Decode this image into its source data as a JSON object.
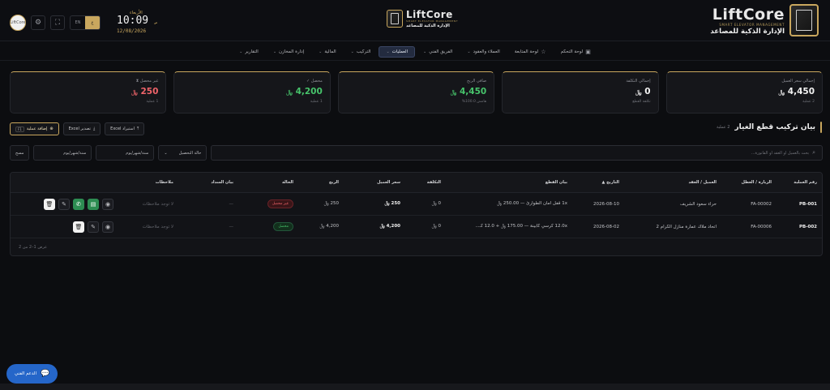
{
  "header": {
    "brand": {
      "name": "LiftCore",
      "tagline": "SMART ELEVATOR MANAGEMENT",
      "subtitle": "الإدارة الذكية للمصاعد"
    },
    "center_brand": {
      "name": "LiftCore",
      "tagline": "SMART ELEVATOR MANAGEMENT",
      "subtitle": "الإدارة الذكية للمصاعد"
    },
    "clock": {
      "day": "الأربعاء",
      "time": "10:09",
      "ampm": "ص",
      "date": "12/08/2026"
    },
    "lang": {
      "en": "EN",
      "ar": "ع"
    },
    "avatar_text": "LiftCore",
    "icons": {
      "settings": "gear-icon",
      "fullscreen": "fullscreen-icon"
    }
  },
  "nav": [
    {
      "label": "لوحة التحكم",
      "icon": "▣",
      "chev": ""
    },
    {
      "label": "لوحة المتابعة",
      "icon": "☆",
      "chev": ""
    },
    {
      "label": "العملاء والعقود",
      "icon": "",
      "chev": "⌄"
    },
    {
      "label": "الفريق الفني",
      "icon": "",
      "chev": "⌄"
    },
    {
      "label": "العمليات",
      "icon": "",
      "chev": "⌄",
      "active": true
    },
    {
      "label": "التركيب",
      "icon": "",
      "chev": "⌄"
    },
    {
      "label": "المالية",
      "icon": "",
      "chev": "⌄"
    },
    {
      "label": "إدارة المخازن",
      "icon": "",
      "chev": "⌄"
    },
    {
      "label": "التقارير",
      "icon": "",
      "chev": "⌄"
    }
  ],
  "cards": [
    {
      "label": "إجمالي سعر العميل",
      "value": "4,450",
      "currency": "﷼",
      "sub": "2 عملية",
      "color": "#f2f2f2"
    },
    {
      "label": "إجمالي التكلفة",
      "value": "0",
      "currency": "﷼",
      "sub": "تكلفة القطع",
      "color": "#f2f2f2"
    },
    {
      "label": "صافي الربح",
      "value": "4,450",
      "currency": "﷼",
      "sub": "هامش 100.0%",
      "color": "#47c46b"
    },
    {
      "label": "محصل ✓",
      "value": "4,200",
      "currency": "﷼",
      "sub": "1 عملية",
      "color": "#47c46b"
    },
    {
      "label": "غير محصل ⧗",
      "value": "250",
      "currency": "﷼",
      "sub": "1 عملية",
      "color": "#f0646a"
    }
  ],
  "section": {
    "title": "بيان تركيب قطع الغيار",
    "count": "2 عملية"
  },
  "actions": {
    "import_label": "استيراد Excel",
    "export_label": "تصدير Excel",
    "add_label": "إضافة عملية",
    "add_shortcut": "F1"
  },
  "filters": {
    "search_placeholder": "بحث بالعميل أو العقد أو الفاتورة...",
    "status_label": "حالة التحصيل",
    "date_from": "سنة/شهر/يوم",
    "date_to": "سنة/شهر/يوم",
    "clear_label": "مسح"
  },
  "table": {
    "headers": {
      "id": "رقم العملية",
      "invoice": "الزيارة / العطل",
      "client": "العميل / العقد",
      "date": "التاريخ ▲",
      "parts": "بيان القطع",
      "cost": "التكلفة",
      "price": "سعر العميل",
      "profit": "الربح",
      "status": "الحالة",
      "payment": "بيان السداد",
      "notes": "ملاحظات"
    },
    "rows": [
      {
        "id": "PB-001",
        "invoice": "FA-00002",
        "client": "حراء سعود الشريف",
        "date": "2026-08-10",
        "parts": "1x قفل أمان الطوارئ — 250.00 ﷼",
        "cost": "0 ﷼",
        "price": "250 ﷼",
        "profit": "250 ﷼",
        "status": "غير محصل",
        "status_type": "red",
        "payment": "—",
        "notes": "لا توجد ملاحظات"
      },
      {
        "id": "PB-002",
        "invoice": "FA-00006",
        "client": "اتحاد ملاك عمارة منازل الكرام 2",
        "date": "2026-08-02",
        "parts": "12.0x كرسي كابينة — 175.00 ﷼ + 12.0 كـ...",
        "cost": "0 ﷼",
        "price": "4,200 ﷼",
        "profit": "4,200 ﷼",
        "status": "محصل",
        "status_type": "green",
        "payment": "—",
        "notes": "لا توجد ملاحظات"
      }
    ],
    "footer": "عرض 1–2 من 2"
  },
  "support": {
    "label": "الدعم الفني"
  }
}
